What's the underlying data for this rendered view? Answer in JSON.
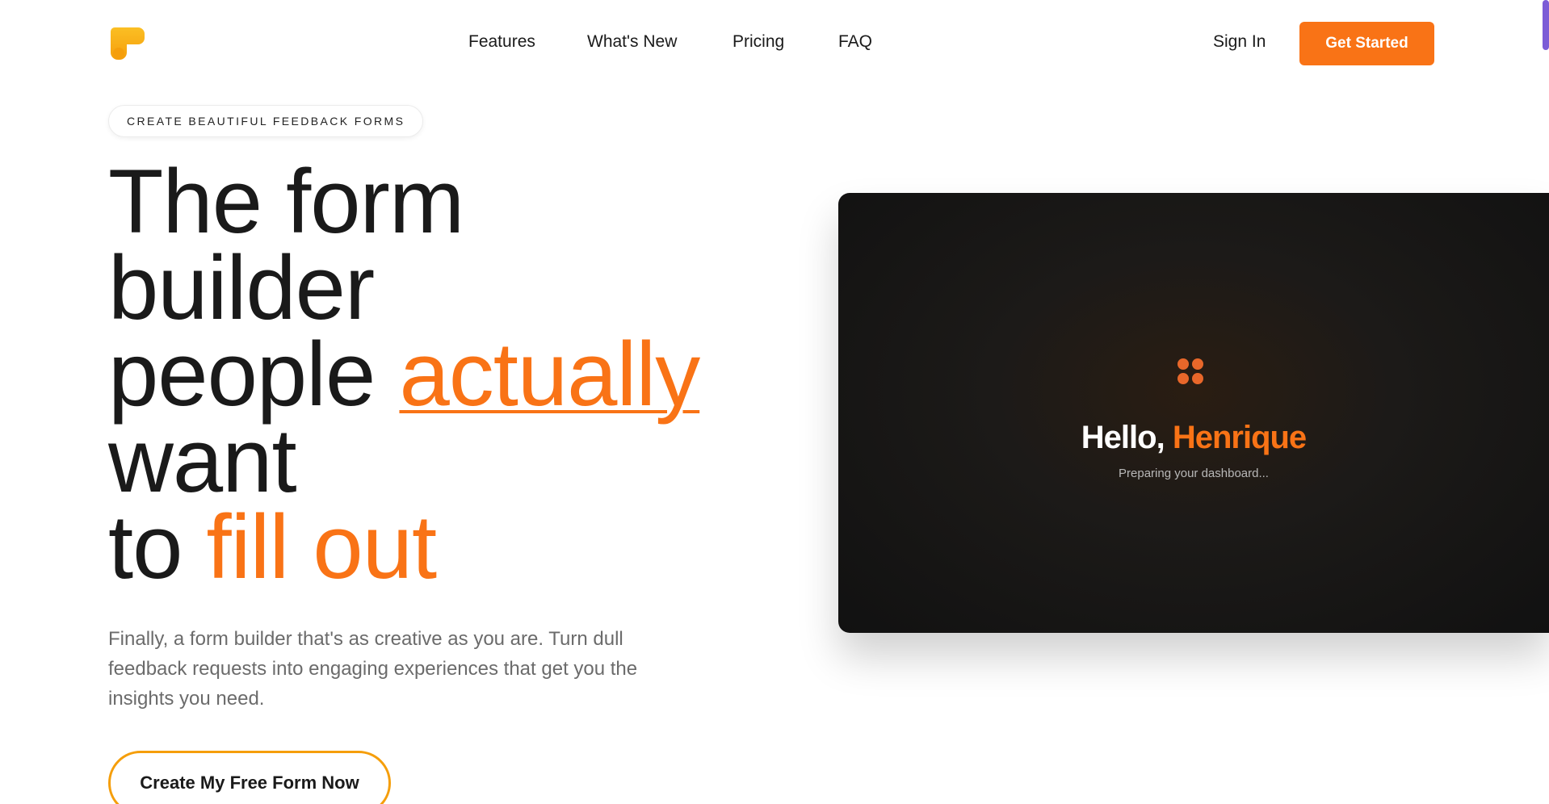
{
  "header": {
    "nav": [
      {
        "label": "Features"
      },
      {
        "label": "What's New"
      },
      {
        "label": "Pricing"
      },
      {
        "label": "FAQ"
      }
    ],
    "sign_in_label": "Sign In",
    "get_started_label": "Get Started",
    "logo_icon": "brand-logo-icon"
  },
  "hero": {
    "eyebrow": "CREATE BEAUTIFUL FEEDBACK FORMS",
    "headline": {
      "line1": "The form",
      "line2": "builder",
      "line3_prefix": "people ",
      "line3_accent": "actually",
      "line4": "want",
      "line5_prefix": "to ",
      "line5_accent": "fill out"
    },
    "subtext": "Finally, a form builder that's as creative as you are. Turn dull feedback requests into engaging experiences that get you the insights you need.",
    "cta_label": "Create My Free Form Now"
  },
  "preview": {
    "greeting_prefix": "Hello,",
    "greeting_name": " Henrique",
    "loading_text": "Preparing your dashboard...",
    "loader_icon": "loading-dots-icon"
  },
  "colors": {
    "accent": "#f97316",
    "cta_border": "#f59e0b",
    "preview_bg": "#111111"
  }
}
